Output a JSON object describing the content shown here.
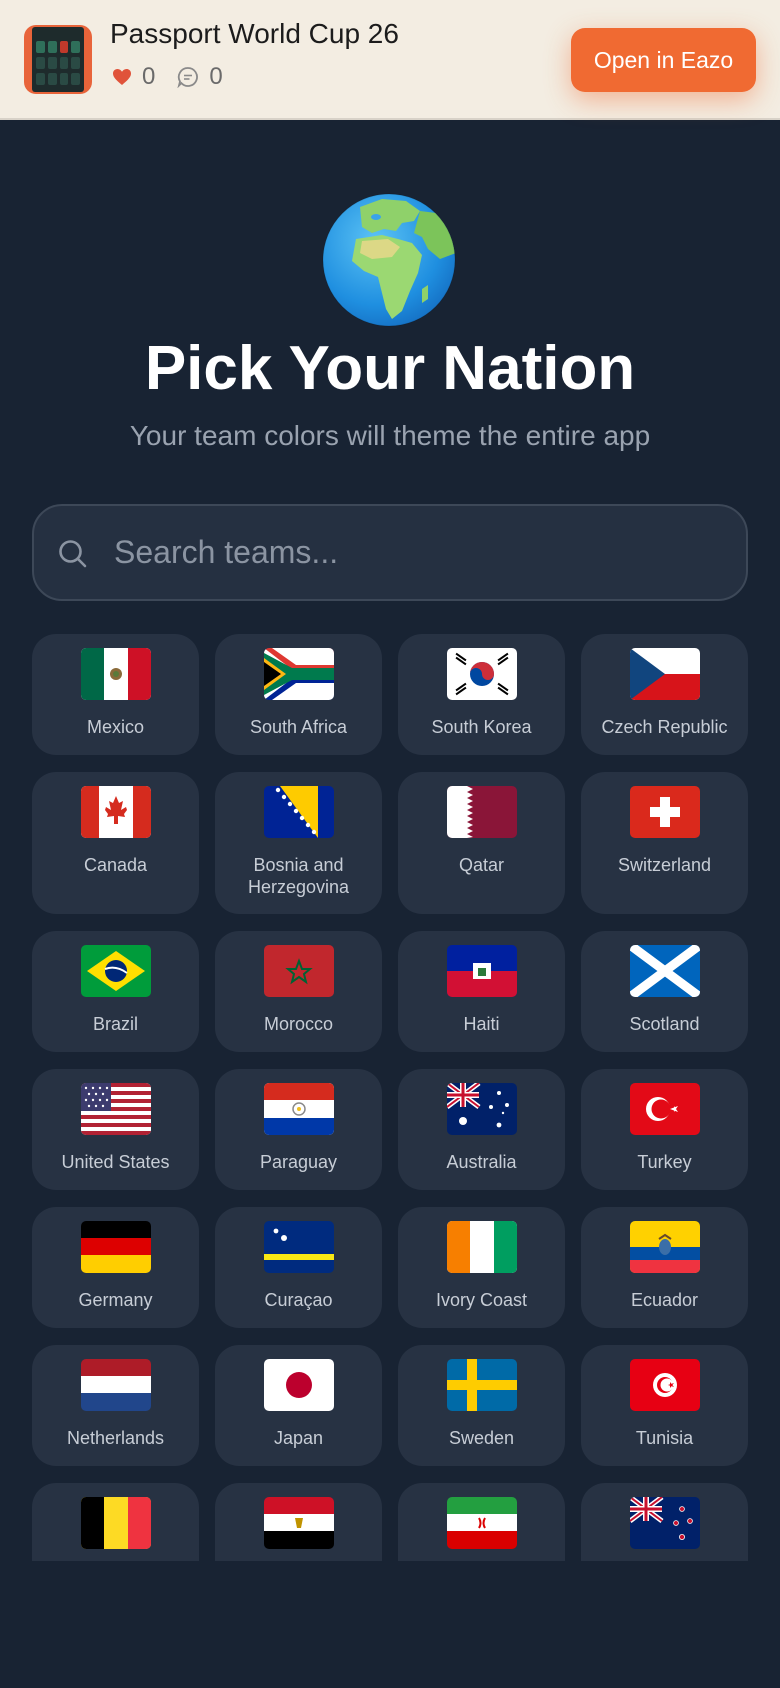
{
  "banner": {
    "app_title": "Passport World Cup 26",
    "likes": "0",
    "comments": "0",
    "open_button": "Open in Eazo",
    "accent_color": "#f06a32"
  },
  "hero": {
    "icon": "globe-icon",
    "title": "Pick Your Nation",
    "subtitle": "Your team colors will theme the entire app"
  },
  "search": {
    "placeholder": "Search teams...",
    "value": ""
  },
  "teams": [
    {
      "name": "Mexico",
      "flag": "mexico-flag-icon"
    },
    {
      "name": "South Africa",
      "flag": "south-africa-flag-icon"
    },
    {
      "name": "South Korea",
      "flag": "south-korea-flag-icon"
    },
    {
      "name": "Czech Republic",
      "flag": "czech-republic-flag-icon"
    },
    {
      "name": "Canada",
      "flag": "canada-flag-icon"
    },
    {
      "name": "Bosnia and Herzegovina",
      "flag": "bosnia-flag-icon"
    },
    {
      "name": "Qatar",
      "flag": "qatar-flag-icon"
    },
    {
      "name": "Switzerland",
      "flag": "switzerland-flag-icon"
    },
    {
      "name": "Brazil",
      "flag": "brazil-flag-icon"
    },
    {
      "name": "Morocco",
      "flag": "morocco-flag-icon"
    },
    {
      "name": "Haiti",
      "flag": "haiti-flag-icon"
    },
    {
      "name": "Scotland",
      "flag": "scotland-flag-icon"
    },
    {
      "name": "United States",
      "flag": "united-states-flag-icon"
    },
    {
      "name": "Paraguay",
      "flag": "paraguay-flag-icon"
    },
    {
      "name": "Australia",
      "flag": "australia-flag-icon"
    },
    {
      "name": "Turkey",
      "flag": "turkey-flag-icon"
    },
    {
      "name": "Germany",
      "flag": "germany-flag-icon"
    },
    {
      "name": "Curaçao",
      "flag": "curacao-flag-icon"
    },
    {
      "name": "Ivory Coast",
      "flag": "ivory-coast-flag-icon"
    },
    {
      "name": "Ecuador",
      "flag": "ecuador-flag-icon"
    },
    {
      "name": "Netherlands",
      "flag": "netherlands-flag-icon"
    },
    {
      "name": "Japan",
      "flag": "japan-flag-icon"
    },
    {
      "name": "Sweden",
      "flag": "sweden-flag-icon"
    },
    {
      "name": "Tunisia",
      "flag": "tunisia-flag-icon"
    },
    {
      "name": "",
      "flag": "belgium-flag-icon"
    },
    {
      "name": "",
      "flag": "egypt-flag-icon"
    },
    {
      "name": "",
      "flag": "iran-flag-icon"
    },
    {
      "name": "",
      "flag": "new-zealand-flag-icon"
    }
  ]
}
